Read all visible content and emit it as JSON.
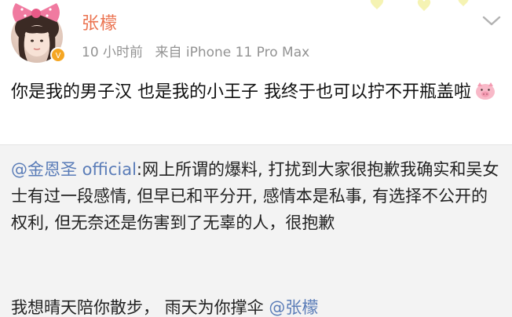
{
  "user": {
    "name": "张檬",
    "time": "10 小时前",
    "source": "来自 iPhone 11 Pro Max"
  },
  "post": {
    "text": "你是我的男子汉  也是我的小王子  我终于也可以拧不开瓶盖啦",
    "emoji": "pig-face-icon"
  },
  "repost": {
    "author": "@金恩圣 official",
    "separator": ":",
    "text": "网上所谓的爆料, 打扰到大家很抱歉我确实和吴女士有过一段感情, 但早已和平分开, 感情本是私事, 有选择不公开的权利, 但无奈还是伤害到了无辜的人，很抱歉"
  },
  "reply": {
    "text": "我想晴天陪你散步，  雨天为你撑伞 ",
    "mention": "@张檬"
  },
  "colors": {
    "username": "#eb7350",
    "mention": "#5b7db8",
    "meta": "#939393",
    "repost_bg": "#f3f3f3"
  }
}
